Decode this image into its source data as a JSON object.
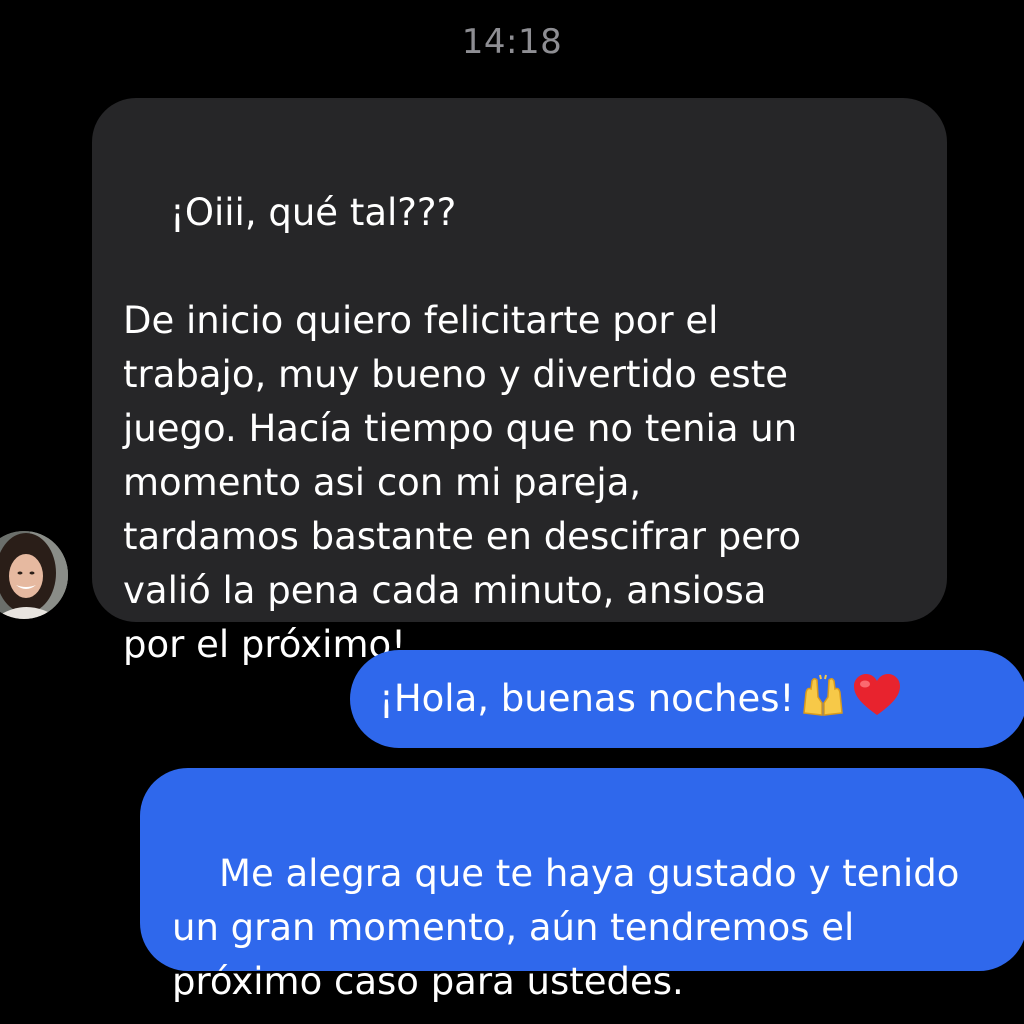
{
  "conversation": {
    "timestamp": "14:18",
    "messages": [
      {
        "sender": "contact",
        "text": "¡Oiii, qué tal???\n\nDe inicio quiero felicitarte por el\ntrabajo, muy bueno y divertido este\njuego. Hacía tiempo que no tenia un\nmomento asi con mi pareja,\ntardamos bastante en descifrar pero\nvalió la pena cada minuto, ansiosa\npor el próximo!"
      },
      {
        "sender": "me",
        "text": "¡Hola, buenas noches!",
        "emojis": [
          "raising-hands-emoji",
          "red-heart-emoji"
        ]
      },
      {
        "sender": "me",
        "text": "Me alegra que te haya gustado y tenido\nun gran momento, aún tendremos el\npróximo caso para ustedes."
      }
    ]
  },
  "colors": {
    "background": "#000000",
    "incoming_bubble": "#262628",
    "outgoing_bubble": "#2f68ec",
    "timestamp": "#8e8e93",
    "text": "#ffffff"
  }
}
